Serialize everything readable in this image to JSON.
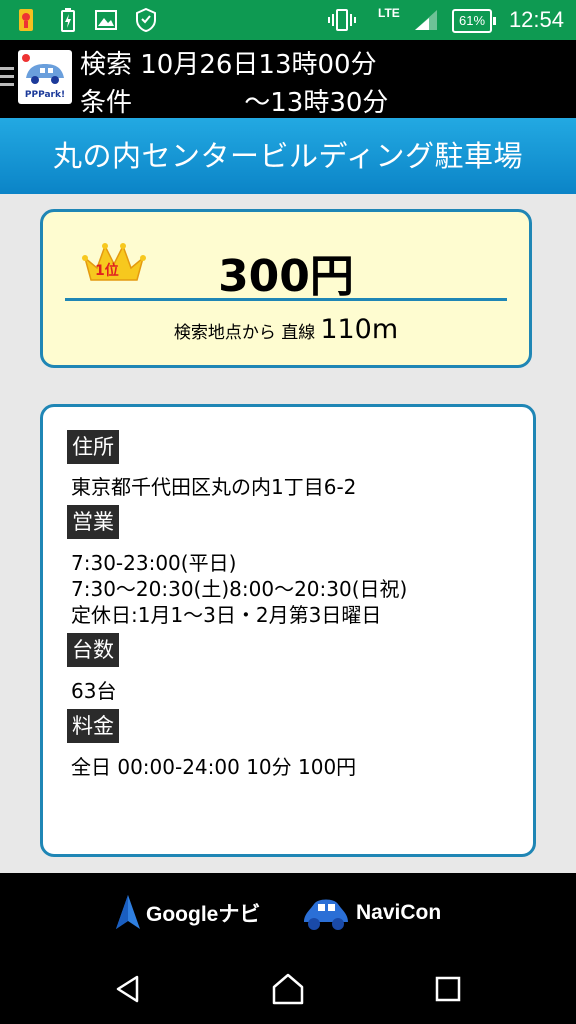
{
  "status_bar": {
    "time": "12:54",
    "battery": "61%",
    "network": "LTE",
    "icons": [
      "app-notification-icon",
      "battery-charging-icon",
      "image-icon",
      "shield-icon",
      "vibrate-icon",
      "signal-icon"
    ]
  },
  "header": {
    "line1": "検索 10月26日13時00分",
    "line2": "条件　　　　 ～13時30分",
    "logo_text": "PPPark!"
  },
  "title": "丸の内センタービルディング駐車場",
  "price_card": {
    "rank": "1位",
    "price": "300円",
    "distance_label": "検索地点から 直線",
    "distance_value": "110m"
  },
  "info": {
    "address_label": "住所",
    "address": "東京都千代田区丸の内1丁目6-2",
    "hours_label": "営業",
    "hours": [
      "7:30-23:00(平日)",
      "7:30～20:30(土)8:00～20:30(日祝)",
      "定休日:1月1～3日・2月第3日曜日"
    ],
    "count_label": "台数",
    "count": "63台",
    "fee_label": "料金",
    "fee": "全日 00:00-24:00 10分 100円"
  },
  "navi": {
    "google": "Googleナビ",
    "navicon": "NaviCon"
  },
  "colors": {
    "status_bar": "#0e9a52",
    "title_bar": "#1a9ad6",
    "card_border": "#1f86b5",
    "price_bg": "#fefcd0"
  }
}
